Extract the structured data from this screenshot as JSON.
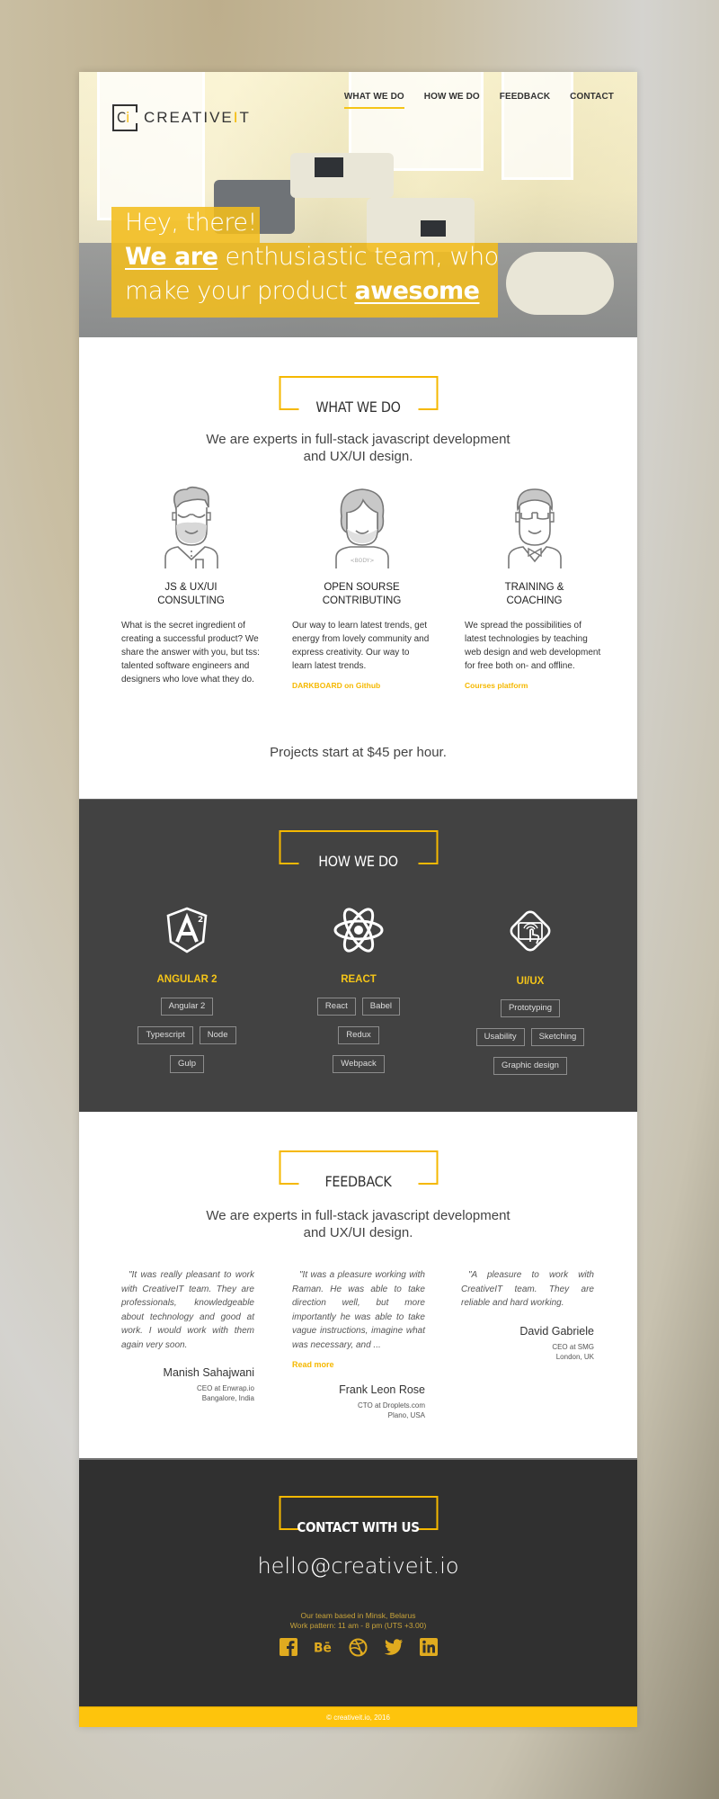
{
  "brand": {
    "logo_mark": "Ci",
    "logo_mark_accent": "i",
    "name_prefix": "CREATIVE",
    "name_accent": "I",
    "name_suffix": "T",
    "accent_color": "#f5b800"
  },
  "nav": {
    "items": [
      {
        "label": "WHAT WE DO",
        "active": true
      },
      {
        "label": "HOW WE DO",
        "active": false
      },
      {
        "label": "FEEDBACK",
        "active": false
      },
      {
        "label": "CONTACT",
        "active": false
      }
    ]
  },
  "hero": {
    "line1": "Hey, there!",
    "line2_bold": "We are",
    "line2_rest": " enthusiastic team, who",
    "line3_rest": "make your product ",
    "line3_bold": "awesome"
  },
  "what_we_do": {
    "title": "WHAT WE DO",
    "lead_line1": "We are experts in full-stack javascript development",
    "lead_line2": "and UX/UI design.",
    "columns": [
      {
        "icon": "bearded-developer-icon",
        "title_line1": "JS & UX/UI",
        "title_line2": "CONSULTING",
        "text": "What is the secret ingredient of creating a successful product? We share the answer with you, but tss: talented software engineers and designers who love what they do.",
        "link": ""
      },
      {
        "icon": "open-source-person-icon",
        "badge": "<BODY>",
        "title_line1": "OPEN SOURSE",
        "title_line2": "CONTRIBUTING",
        "text": "Our way to learn latest trends, get energy from lovely community and express creativity. Our way to learn latest trends.",
        "link": "DARKBOARD on Github"
      },
      {
        "icon": "trainer-person-icon",
        "title_line1": "TRAINING &",
        "title_line2": "COACHING",
        "text": "We spread the possibilities of latest technologies by teaching web design and web development for free both on- and offline.",
        "link": "Courses platform"
      }
    ],
    "price": "Projects start at $45 per hour."
  },
  "how_we_do": {
    "title": "HOW WE DO",
    "techs": [
      {
        "icon": "angular-icon",
        "name": "ANGULAR 2",
        "tags": [
          [
            "Angular 2"
          ],
          [
            "Typescript",
            "Node"
          ],
          [
            "Gulp"
          ]
        ]
      },
      {
        "icon": "react-icon",
        "name": "REACT",
        "tags": [
          [
            "React",
            "Babel"
          ],
          [
            "Redux"
          ],
          [
            "Webpack"
          ]
        ]
      },
      {
        "icon": "touch-screen-icon",
        "name": "UI/UX",
        "tags": [
          [
            "Prototyping"
          ],
          [
            "Usability",
            "Sketching"
          ],
          [
            "Graphic design"
          ]
        ]
      }
    ]
  },
  "feedback": {
    "title": "FEEDBACK",
    "lead_line1": "We are experts in full-stack javascript development",
    "lead_line2": "and UX/UI design.",
    "items": [
      {
        "quote": "\"It was really pleasant to work with CreativeIT team. They are professionals, knowledgeable about technology and good at work. I would work with them again very soon.",
        "read_more": "",
        "name": "Manish Sahajwani",
        "role": "CEO at Enwrap.io",
        "location": "Bangalore, India"
      },
      {
        "quote": "\"It was a pleasure working with Raman. He was able to take direction well, but more importantly he was able to take vague instructions, imagine what was necessary, and ...",
        "read_more": "Read more",
        "name": "Frank Leon Rose",
        "role": "CTO at Droplets.com",
        "location": "Plano, USA"
      },
      {
        "quote": "\"A pleasure to work with CreativeIT team. They are reliable and hard working.",
        "read_more": "",
        "name": "David Gabriele",
        "role": "CEO at SMG",
        "location": "London, UK"
      }
    ]
  },
  "contact": {
    "title": "CONTACT WITH US",
    "email": "hello@creativeit.io",
    "info_line1": "Our team based in Minsk, Belarus",
    "info_line2": "Work pattern: 11 am - 8 pm (UTS +3.00)",
    "socials": [
      "facebook-icon",
      "behance-icon",
      "dribbble-icon",
      "twitter-icon",
      "linkedin-icon"
    ]
  },
  "footer": {
    "copyright": "© creativeit.io, 2016"
  }
}
